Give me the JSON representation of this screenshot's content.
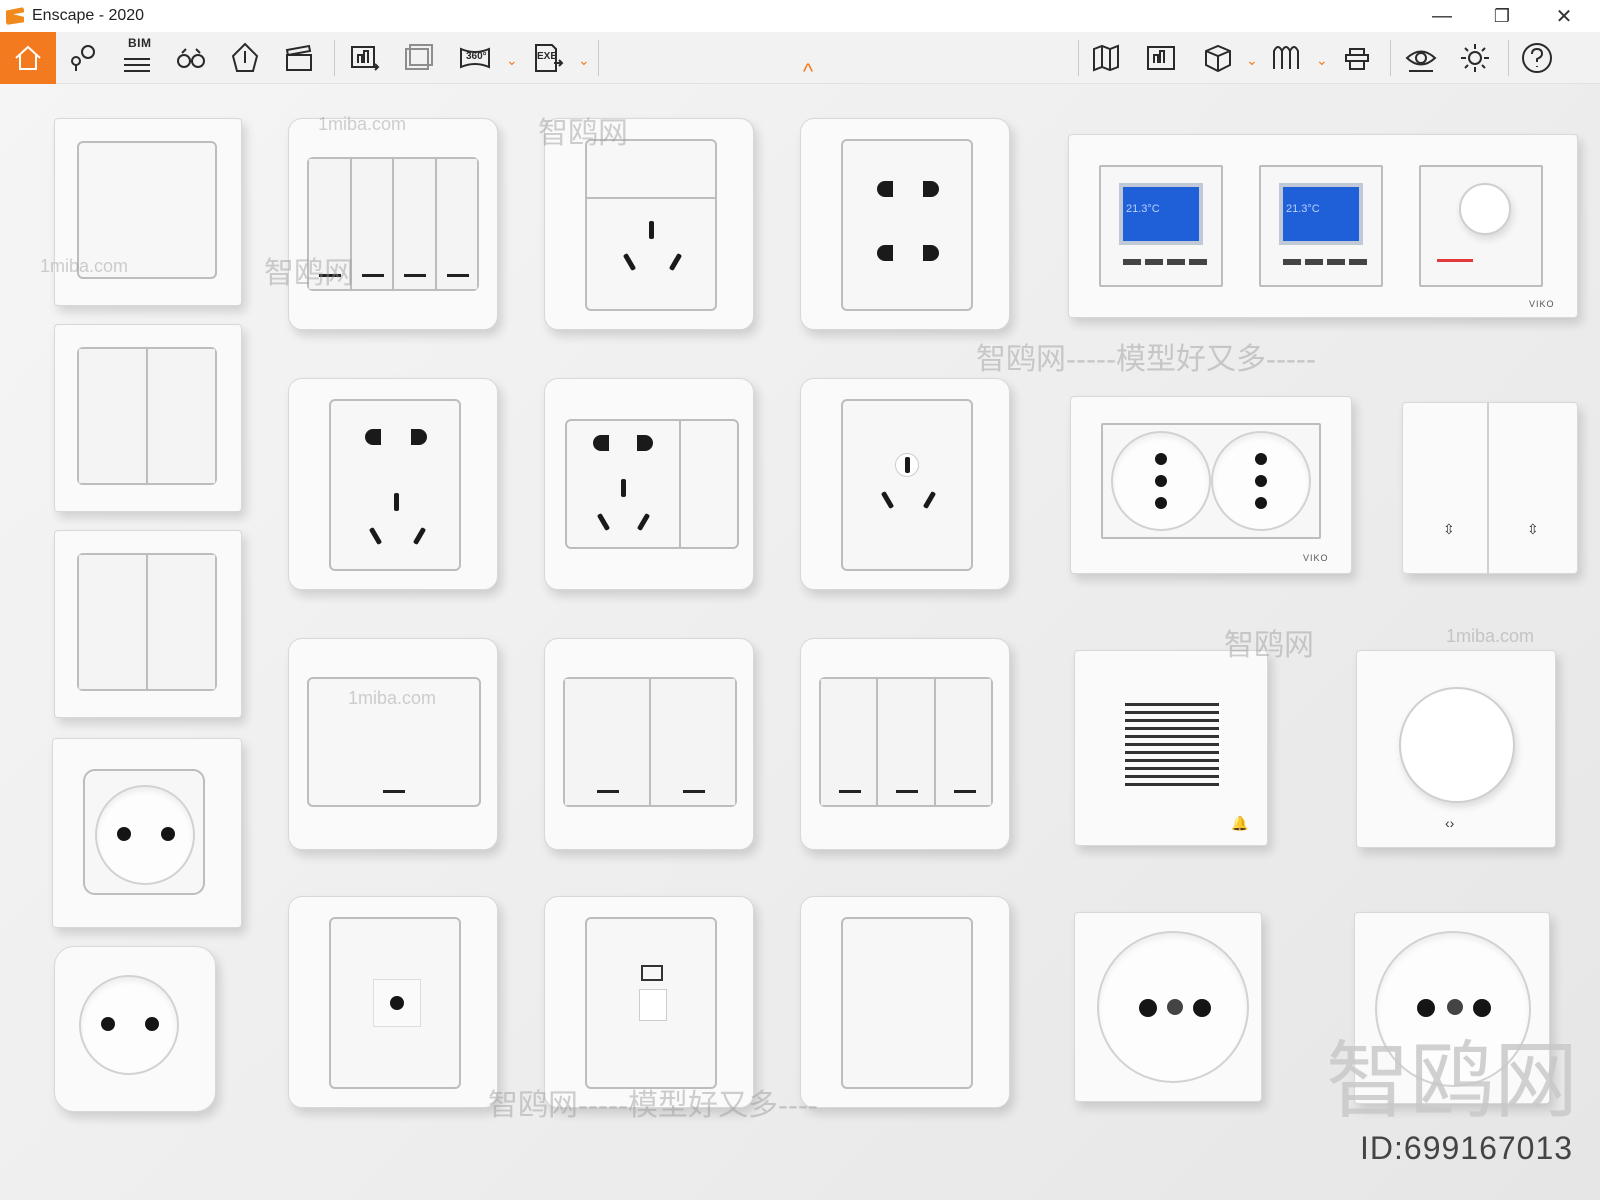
{
  "window": {
    "title": "Enscape - 2020",
    "minimize": "—",
    "restore": "❐",
    "close": "✕"
  },
  "toolbar": {
    "home": "home-icon",
    "bim_label": "BIM",
    "collapse": "^",
    "left_tools": [
      "views-icon",
      "bim-icon",
      "binoculars-icon",
      "objects-icon",
      "video-editor-icon",
      "screenshot-icon",
      "batch-render-icon",
      "panorama-360-icon",
      "exe-export-icon"
    ],
    "right_tools": [
      "map-icon",
      "bim-info-icon",
      "asset-library-icon",
      "material-editor-icon",
      "settings-cap-icon",
      "visual-settings-icon",
      "gear-icon",
      "help-icon"
    ],
    "pano_label": "360°",
    "exe_label": "EXE"
  },
  "scene": {
    "thermostat_temp_1": "21.3°C",
    "thermostat_temp_2": "21.3°C",
    "brand_label": "VIKO",
    "brand_label_2": "VIKO",
    "watermark_site": "1miba.com",
    "watermark_cn": "智鸥网",
    "watermark_slogan": "智鸥网-----模型好又多-----",
    "watermark_slogan_2": "智鸥网-----模型好又多----",
    "watermark_big": "智鸥网",
    "id_text": "ID:699167013"
  }
}
